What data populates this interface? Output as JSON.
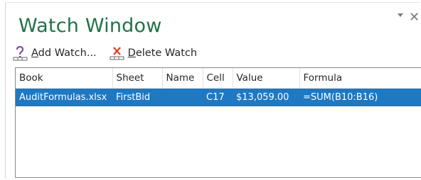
{
  "window": {
    "title": "Watch Window",
    "close_glyph": "✕",
    "dropdown_icon": "triangle-down-icon",
    "close_icon": "close-icon"
  },
  "toolbar": {
    "add_watch": {
      "accel": "A",
      "rest": "dd Watch...",
      "icon": "add-watch-icon"
    },
    "delete_watch": {
      "prefix": "",
      "accel": "D",
      "rest": "elete Watch",
      "icon": "delete-watch-icon"
    }
  },
  "table": {
    "columns": [
      "Book",
      "Sheet",
      "Name",
      "Cell",
      "Value",
      "Formula"
    ],
    "rows": [
      {
        "book": "AuditFormulas.xlsx",
        "sheet": "FirstBid",
        "name": "",
        "cell": "C17",
        "value": "$13,059.00",
        "formula": "=SUM(B10:B16)",
        "selected": true
      }
    ]
  },
  "colors": {
    "title": "#217346",
    "selection": "#1e78c2",
    "grid_border": "#8a8a8a"
  }
}
